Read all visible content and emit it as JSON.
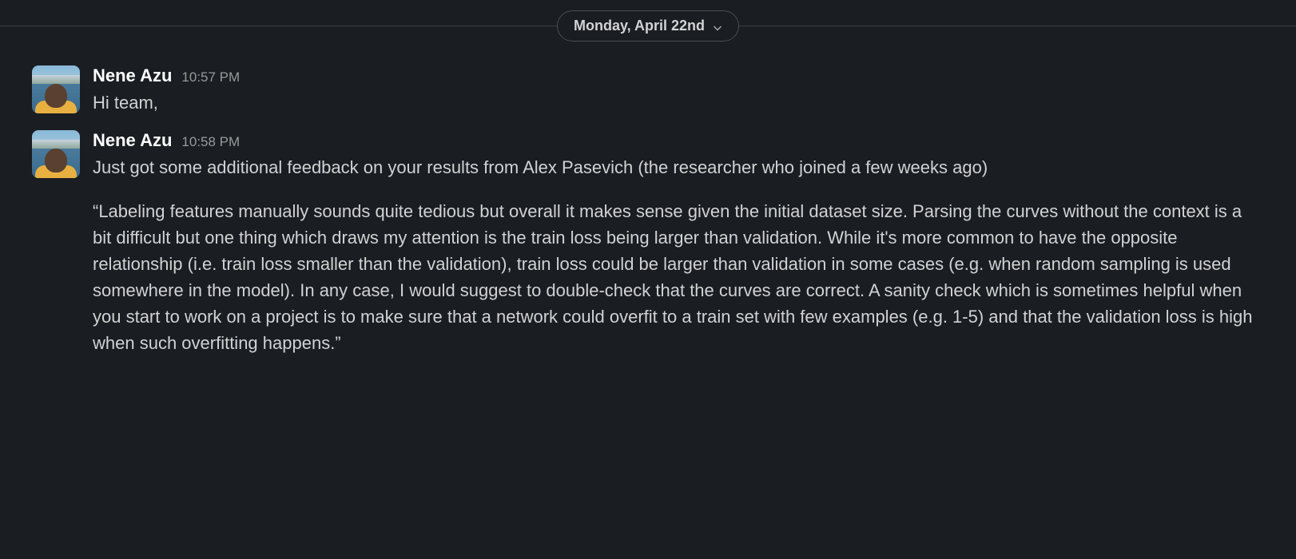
{
  "dateDivider": {
    "label": "Monday, April 22nd"
  },
  "messages": [
    {
      "author": "Nene Azu",
      "timestamp": "10:57 PM",
      "paragraphs": [
        "Hi team,"
      ]
    },
    {
      "author": "Nene Azu",
      "timestamp": "10:58 PM",
      "paragraphs": [
        "Just got some additional feedback on your results from Alex Pasevich (the researcher who joined a few weeks ago)",
        "“Labeling features manually sounds quite tedious but overall it makes sense given the initial dataset size. Parsing the curves without the context is a bit difficult but one thing which draws my attention is the train loss being larger than validation. While it's more common to have the opposite relationship (i.e. train loss smaller than the validation), train loss could be larger than validation in some cases (e.g. when random sampling is used somewhere in the model). In any case, I would suggest to double-check that the curves are correct. A sanity check which is sometimes helpful when you start to work on a project is to make sure that a network could overfit to a train set with few examples (e.g. 1-5) and that the validation loss is high when such overfitting happens.”"
      ]
    }
  ]
}
